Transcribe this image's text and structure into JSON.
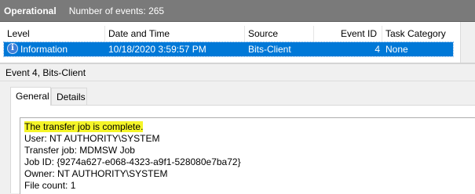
{
  "header": {
    "title": "Operational",
    "count_label": "Number of events: 265"
  },
  "columns": [
    "Level",
    "Date and Time",
    "Source",
    "Event ID",
    "Task Category"
  ],
  "selected_row": {
    "level": "Information",
    "level_icon": "info-icon",
    "date_time": "10/18/2020 3:59:57 PM",
    "source": "Bits-Client",
    "event_id": "4",
    "task_category": "None"
  },
  "detail": {
    "title": "Event 4, Bits-Client",
    "tabs": [
      "General",
      "Details"
    ],
    "active_tab": "General",
    "lines": [
      "The transfer job is complete.",
      "User: NT AUTHORITY\\SYSTEM",
      "Transfer job: MDMSW Job",
      "Job ID: {9274a627-e068-4323-a9f1-528080e7ba72}",
      "Owner: NT AUTHORITY\\SYSTEM",
      "File count: 1"
    ],
    "highlight_color": "#f5f528"
  },
  "colors": {
    "selection": "#0078d7",
    "header_bar": "#7a7a7a"
  }
}
